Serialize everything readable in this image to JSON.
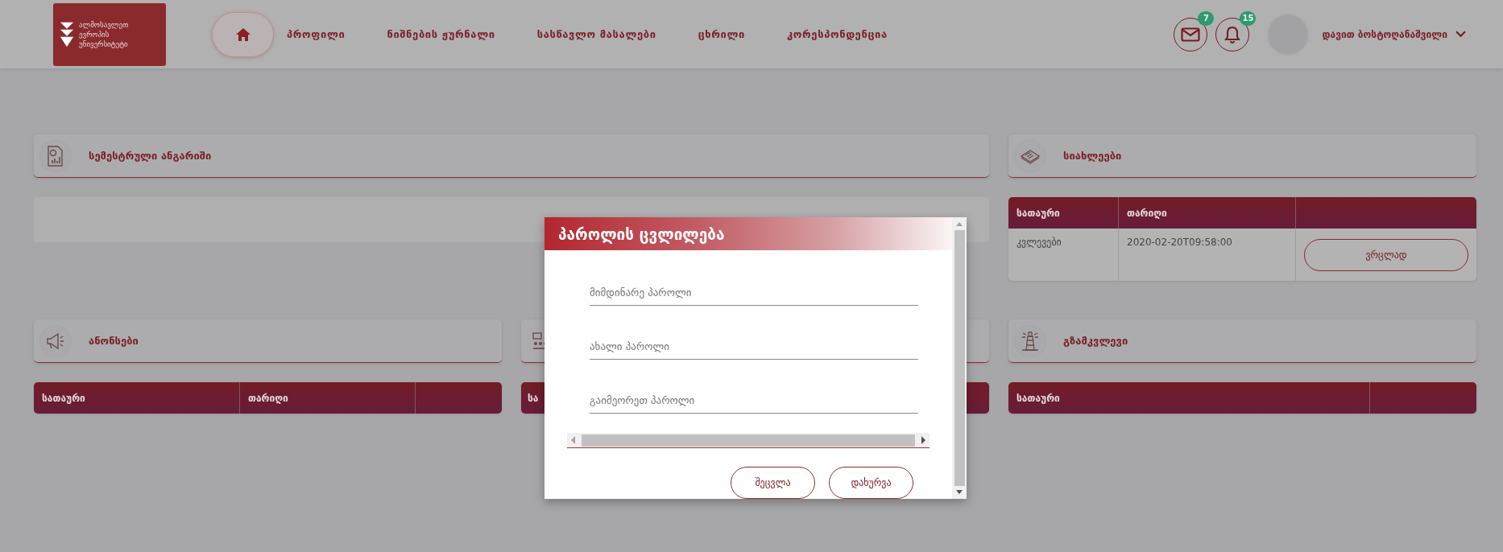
{
  "logo": {
    "lines": [
      "ალმოსავლეთ",
      "ევროპის",
      "უნივერსიტეტი"
    ]
  },
  "nav": [
    {
      "kind": "home",
      "selected": true
    },
    {
      "kind": "link",
      "label": "პროფილი",
      "selected": false
    },
    {
      "kind": "link",
      "label": "ნიშნების ჟურნალი",
      "selected": false
    },
    {
      "kind": "link",
      "label": "სასწავლო მასალები",
      "selected": false
    },
    {
      "kind": "link",
      "label": "ცხრილი",
      "selected": false
    },
    {
      "kind": "link",
      "label": "კორესპონდენცია",
      "selected": false
    }
  ],
  "header_icons": [
    {
      "kind": "mail",
      "badge": "7"
    },
    {
      "kind": "bell",
      "badge": "15"
    }
  ],
  "user": {
    "name": "დავით ბოსტოღანაშვილი"
  },
  "semester_report": {
    "title": "სემესტრული ანგარიში"
  },
  "news": {
    "title": "სიახლეები",
    "columns": [
      "სათაური",
      "თარიღი",
      ""
    ],
    "rows": [
      {
        "title": "კვლევები",
        "date": "2020-02-20T09:58:00",
        "button": "ვრცლად"
      }
    ]
  },
  "announcements": {
    "title": "ანონსები",
    "columns": [
      "სათაური",
      "თარიღი",
      ""
    ]
  },
  "middle_panel": {
    "columns": [
      "სა"
    ]
  },
  "guide": {
    "title": "გზამკვლევი",
    "columns": [
      "სათაური",
      ""
    ]
  },
  "modal": {
    "title": "პაროლის ცვლილება",
    "fields": [
      {
        "placeholder": "მიმდინარე პაროლი"
      },
      {
        "placeholder": "ახალი პაროლი"
      },
      {
        "placeholder": "გაიმეორეთ პაროლი"
      }
    ],
    "buttons": [
      "შეცვლა",
      "დახურვა"
    ]
  }
}
